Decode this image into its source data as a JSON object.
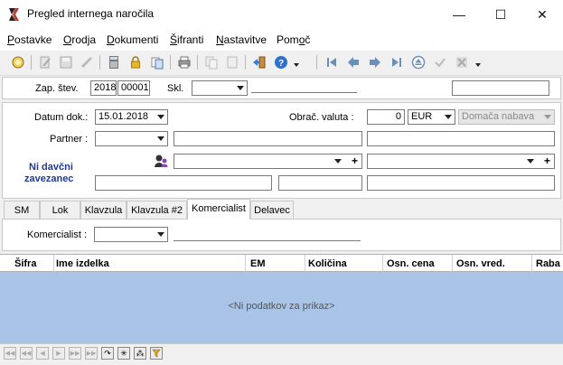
{
  "window": {
    "title": "Pregled internega naročila",
    "controls": {
      "minimize": "—",
      "maximize": "☐",
      "close": "✕"
    }
  },
  "menu": [
    {
      "label": "Postavke"
    },
    {
      "label": "Orodja"
    },
    {
      "label": "Dokumenti"
    },
    {
      "label": "Šifranti"
    },
    {
      "label": "Nastavitve"
    },
    {
      "label": "Pomoč"
    }
  ],
  "header": {
    "zap_label": "Zap. štev.",
    "zap_year": "2018",
    "zap_number": "00001",
    "skl_label": "Skl.",
    "skl_value": "",
    "skl_name": "",
    "right_field": ""
  },
  "doc": {
    "datum_label": "Datum dok.:",
    "datum_value": "15.01.2018",
    "valuta_label": "Obrač. valuta :",
    "valuta_rate": "0",
    "valuta_code": "EUR",
    "nabava_value": "Domača nabava",
    "partner_label": "Partner :",
    "partner_code": "",
    "partner_name": "",
    "partner_extra": "",
    "davcni_line1": "Ni davčni",
    "davcni_line2": "zavezanec",
    "plus_symbol": "+"
  },
  "tabs": [
    {
      "label": "SM"
    },
    {
      "label": "Lok"
    },
    {
      "label": "Klavzula"
    },
    {
      "label": "Klavzula #2"
    },
    {
      "label": "Komercialist",
      "active": true
    },
    {
      "label": "Delavec"
    }
  ],
  "komercialist": {
    "label": "Komercialist :",
    "value": "",
    "name": ""
  },
  "grid": {
    "columns": [
      "Šifra",
      "Ime izdelka",
      "EM",
      "Količina",
      "Osn. cena",
      "Osn. vred.",
      "Raba"
    ],
    "empty_text": "<Ni podatkov za prikaz>"
  },
  "colors": {
    "accent_text": "#1f3a93",
    "grid_empty_bg": "#a9c4e6"
  }
}
